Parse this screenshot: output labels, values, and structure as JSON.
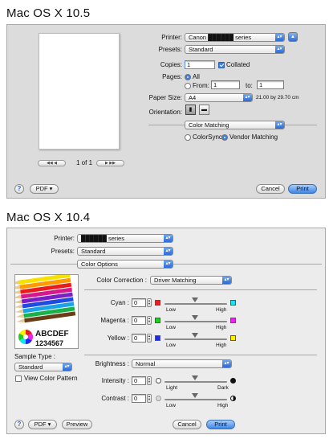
{
  "top": {
    "os_label": "Mac OS X 10.5",
    "printer_label": "Printer:",
    "printer_value": "Canon ██████ series",
    "presets_label": "Presets:",
    "presets_value": "Standard",
    "copies_label": "Copies:",
    "copies_value": "1",
    "collated_label": "Collated",
    "pages_label": "Pages:",
    "pages_all": "All",
    "pages_from": "From:",
    "pages_from_value": "1",
    "pages_to": "to:",
    "pages_to_value": "1",
    "paper_size_label": "Paper Size:",
    "paper_size_value": "A4",
    "paper_dimensions": "21.00 by 29.70 cm",
    "orientation_label": "Orientation:",
    "section_value": "Color Matching",
    "colorsync": "ColorSync",
    "vendor_matching": "Vendor Matching",
    "page_indicator": "1 of 1",
    "pdf_button": "PDF ▾",
    "cancel_button": "Cancel",
    "print_button": "Print",
    "help": "?"
  },
  "bottom": {
    "os_label": "Mac OS X 10.4",
    "printer_label": "Printer:",
    "printer_value": "██████ series",
    "presets_label": "Presets:",
    "presets_value": "Standard",
    "section_value": "Color Options",
    "color_correction_label": "Color Correction :",
    "color_correction_value": "Driver Matching",
    "cyan_label": "Cyan :",
    "cyan_value": "0",
    "magenta_label": "Magenta :",
    "magenta_value": "0",
    "yellow_label": "Yellow :",
    "yellow_value": "0",
    "low": "Low",
    "high": "High",
    "brightness_label": "Brightness :",
    "brightness_value": "Normal",
    "intensity_label": "Intensity :",
    "intensity_value": "0",
    "light": "Light",
    "dark": "Dark",
    "contrast_label": "Contrast :",
    "contrast_value": "0",
    "sample_text_1": "ABCDEF",
    "sample_text_2": "1234567",
    "sample_type_label": "Sample Type :",
    "sample_type_value": "Standard",
    "view_color_pattern": "View Color Pattern",
    "pdf_button": "PDF ▾",
    "preview_button": "Preview",
    "cancel_button": "Cancel",
    "print_button": "Print",
    "help": "?"
  },
  "colors": {
    "cyan": "#19e3ef",
    "red": "#ee1c1c",
    "magenta": "#ee22ee",
    "green": "#22cc22",
    "yellow": "#ffee00",
    "blue": "#1d2be8",
    "accent": "#3d86e8"
  },
  "icons": {
    "arrow": "▾",
    "help": "?",
    "portrait": "portrait-orientation-icon",
    "landscape": "landscape-orientation-icon",
    "pencils": "color-pencils-icon",
    "color_wheel": "color-wheel-icon"
  }
}
